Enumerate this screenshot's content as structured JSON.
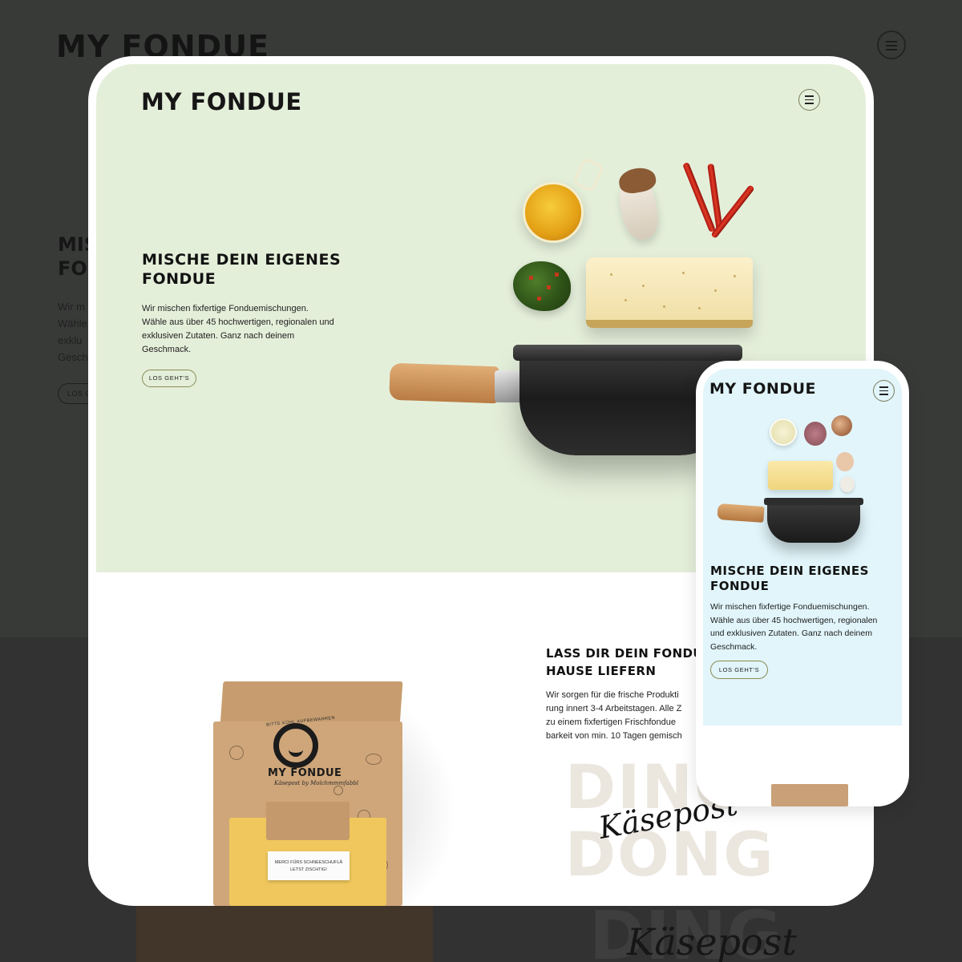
{
  "brand": {
    "logo_prefix": "MY F",
    "logo_o": "O",
    "logo_suffix": "NDUE"
  },
  "hero": {
    "title_line1": "MISCHE DEIN EIGENES",
    "title_line2": "FONDUE",
    "text_line1": "Wir mischen fixfertige Fonduemischungen.",
    "text_line2": "Wähle aus über 45 hochwertigen, regionalen und",
    "text_line3": "exklusiven Zutaten. Ganz nach deinem",
    "text_line4": "Geschmack.",
    "button_label": "LOS GEHT'S"
  },
  "mobile_hero": {
    "text_line1": "Wir mischen fixfertige Fonduemischungen.",
    "text_line2": "Wähle aus über 45 hochwertigen, regionalen",
    "text_line3": "und exklusiven Zutaten. Ganz nach deinem",
    "text_line4": "Geschmack."
  },
  "background": {
    "title_line1": "MIS",
    "title_line2": "FON",
    "text_line1": "Wir m",
    "text_line2": "Wähle",
    "text_line3": "exklu",
    "text_line4": "Gesch",
    "button_label": "LOS G",
    "script": "Käsepost"
  },
  "delivery": {
    "title_line1": "LASS DIR DEIN FONDUE",
    "title_line2": "HAUSE LIEFERN",
    "text_line1": "Wir sorgen für die frische Produkti",
    "text_line2": "rung innert 3-4 Arbeitstagen. Alle Z",
    "text_line3": "zu einem fixfertigen Frischfondue",
    "text_line4": "barkeit von min. 10 Tagen gemisch"
  },
  "promo": {
    "ding": "DING",
    "dong": "DONG",
    "script": "Käsepost"
  },
  "box": {
    "brand": "MY FONDUE",
    "strip": "BITTE KÜHL AUFBEWAHREN",
    "subtitle": "Käsepost by Molchmmmfabbl",
    "card_line1": "MERCI FÜRS SCHNEESCHUFLÄ",
    "card_line2": "LETST ZISCHTIG!"
  },
  "colors": {
    "hero_green": "#e4efda",
    "hero_blue": "#e1f5fa",
    "accent_olive": "#8b8b55"
  },
  "icons": {
    "menu": "hamburger-menu-icon"
  }
}
